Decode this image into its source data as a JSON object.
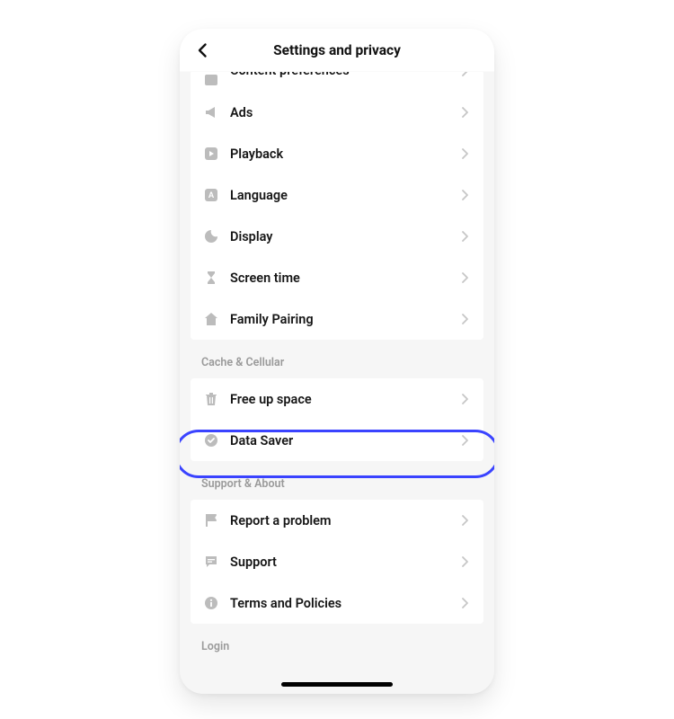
{
  "header": {
    "title": "Settings and privacy"
  },
  "group1": {
    "cutoff_label": "Content preferences",
    "items": [
      {
        "label": "Ads"
      },
      {
        "label": "Playback"
      },
      {
        "label": "Language"
      },
      {
        "label": "Display"
      },
      {
        "label": "Screen time"
      },
      {
        "label": "Family Pairing"
      }
    ]
  },
  "section_cache": {
    "title": "Cache & Cellular"
  },
  "group2": {
    "items": [
      {
        "label": "Free up space"
      },
      {
        "label": "Data Saver"
      }
    ]
  },
  "section_support": {
    "title": "Support & About"
  },
  "group3": {
    "items": [
      {
        "label": "Report a problem"
      },
      {
        "label": "Support"
      },
      {
        "label": "Terms and Policies"
      }
    ]
  },
  "section_login": {
    "title": "Login"
  }
}
